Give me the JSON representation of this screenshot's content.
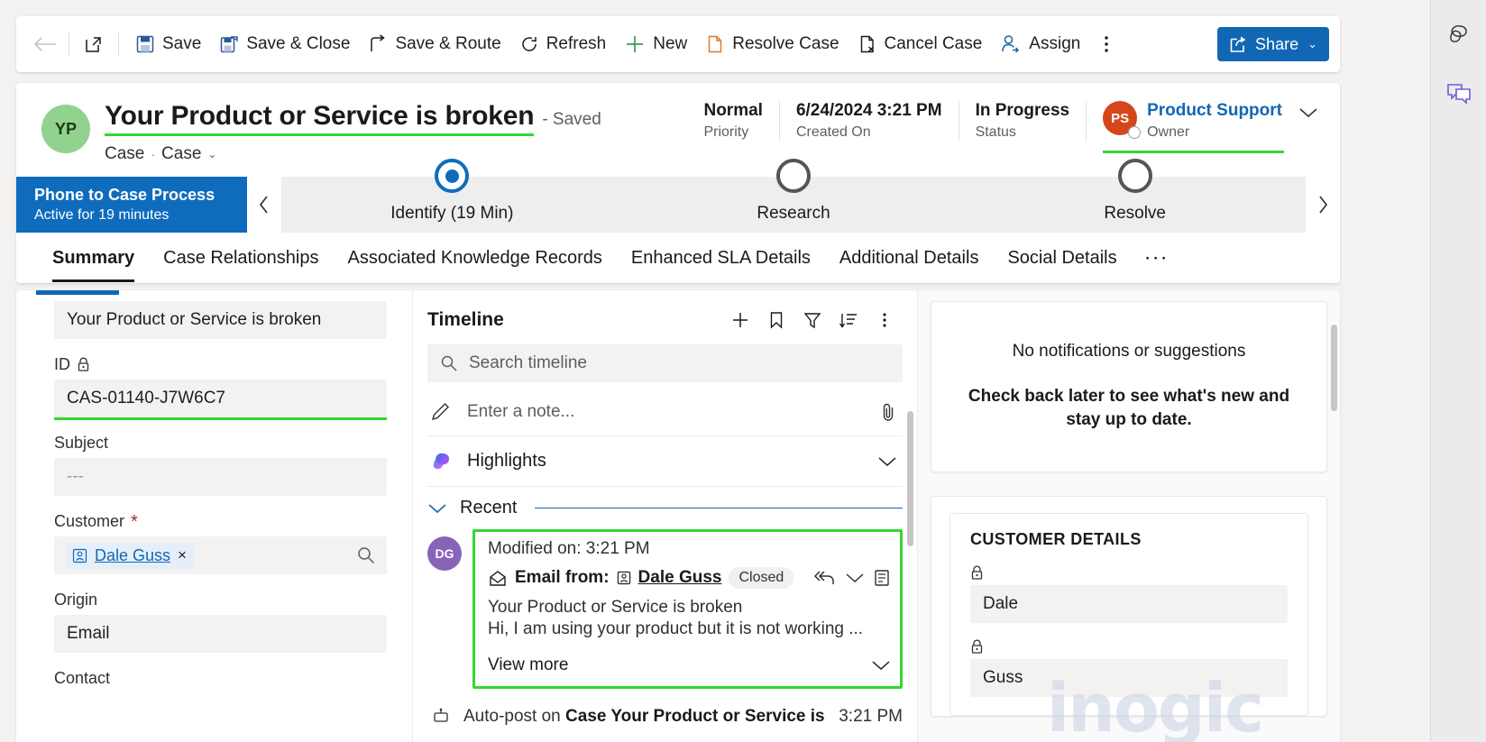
{
  "command_bar": {
    "back_label": "Back",
    "open_form_label": "Open form",
    "buttons": [
      {
        "label": "Save",
        "icon": "save-icon"
      },
      {
        "label": "Save & Close",
        "icon": "save-close-icon"
      },
      {
        "label": "Save & Route",
        "icon": "save-route-icon"
      },
      {
        "label": "Refresh",
        "icon": "refresh-icon"
      },
      {
        "label": "New",
        "icon": "plus-icon"
      },
      {
        "label": "Resolve Case",
        "icon": "resolve-case-icon"
      },
      {
        "label": "Cancel Case",
        "icon": "cancel-case-icon"
      },
      {
        "label": "Assign",
        "icon": "assign-icon"
      }
    ],
    "overflow_label": "More commands",
    "share_label": "Share",
    "share_chevron": "⌄",
    "share_color": "#1267b4"
  },
  "record_header": {
    "avatar_initials": "YP",
    "avatar_color": "#92d28f",
    "title": "Your Product or Service is broken",
    "saved_status": "- Saved",
    "entity": "Case",
    "separator": "·",
    "form_name": "Case",
    "form_chevron": "⌄",
    "meta": [
      {
        "value": "Normal",
        "label": "Priority"
      },
      {
        "value": "6/24/2024 3:21 PM",
        "label": "Created On"
      },
      {
        "value": "In Progress",
        "label": "Status"
      }
    ],
    "owner": {
      "initials": "PS",
      "avatar_color": "#d6461b",
      "name": "Product Support",
      "label": "Owner",
      "name_color": "#1267b4"
    },
    "collapse_chevron": "⌄",
    "accent_color": "#32d732"
  },
  "business_process": {
    "name": "Phone to Case Process",
    "active_for": "Active for 19 minutes",
    "prev_chevron": "‹",
    "next_chevron": "›",
    "stages": [
      {
        "label": "Identify  (19 Min)",
        "active": true
      },
      {
        "label": "Research",
        "active": false
      },
      {
        "label": "Resolve",
        "active": false
      }
    ]
  },
  "form_tabs": {
    "items": [
      {
        "label": "Summary",
        "selected": true
      },
      {
        "label": "Case Relationships",
        "selected": false
      },
      {
        "label": "Associated Knowledge Records",
        "selected": false
      },
      {
        "label": "Enhanced SLA Details",
        "selected": false
      },
      {
        "label": "Additional Details",
        "selected": false
      },
      {
        "label": "Social Details",
        "selected": false
      }
    ],
    "more": "···"
  },
  "left_form": {
    "case_title_value": "Your Product or Service is broken",
    "fields": [
      {
        "label": "ID",
        "locked": true,
        "value": "CAS-01140-J7W6C7",
        "underline": true
      },
      {
        "label": "Subject",
        "locked": false,
        "value": "---",
        "placeholder": true
      },
      {
        "label": "Customer",
        "required": true,
        "lookup": "Dale Guss",
        "lookup_remove": "×"
      },
      {
        "label": "Origin",
        "value": "Email"
      },
      {
        "label": "Contact",
        "value": ""
      }
    ]
  },
  "timeline": {
    "title": "Timeline",
    "actions": [
      "plus-icon",
      "bookmark-icon",
      "filter-icon",
      "sort-icon",
      "more-vertical-icon"
    ],
    "search_placeholder": "Search timeline",
    "note_placeholder": "Enter a note...",
    "highlights_label": "Highlights",
    "recent_label": "Recent",
    "email_entry": {
      "avatar_initials": "DG",
      "avatar_color": "#8764b8",
      "modified_on": "Modified on: 3:21 PM",
      "from_label": "Email from:",
      "from_name": "Dale Guss",
      "state_badge": "Closed",
      "subject": "Your Product or Service is broken",
      "snippet": "Hi, I am using your product but it is not working ...",
      "view_more": "View more",
      "highlight_color": "#32d732"
    },
    "autopost_entry": {
      "prefix": "Auto-post on ",
      "bold": "Case Your Product or Service is bro...",
      "time": "3:21 PM"
    }
  },
  "right_panel": {
    "notifications": {
      "title": "No notifications or suggestions",
      "subtitle": "Check back later to see what's new and stay up to date."
    },
    "customer_details": {
      "heading": "CUSTOMER DETAILS",
      "fields": [
        {
          "locked": true,
          "value": "Dale"
        },
        {
          "locked": true,
          "value": "Guss"
        }
      ]
    }
  },
  "rail": {
    "items": [
      {
        "icon": "copilot-icon",
        "label": "Copilot"
      },
      {
        "icon": "chat-feedback-icon",
        "label": "Feedback"
      }
    ]
  },
  "watermark": {
    "text": "inogic"
  }
}
